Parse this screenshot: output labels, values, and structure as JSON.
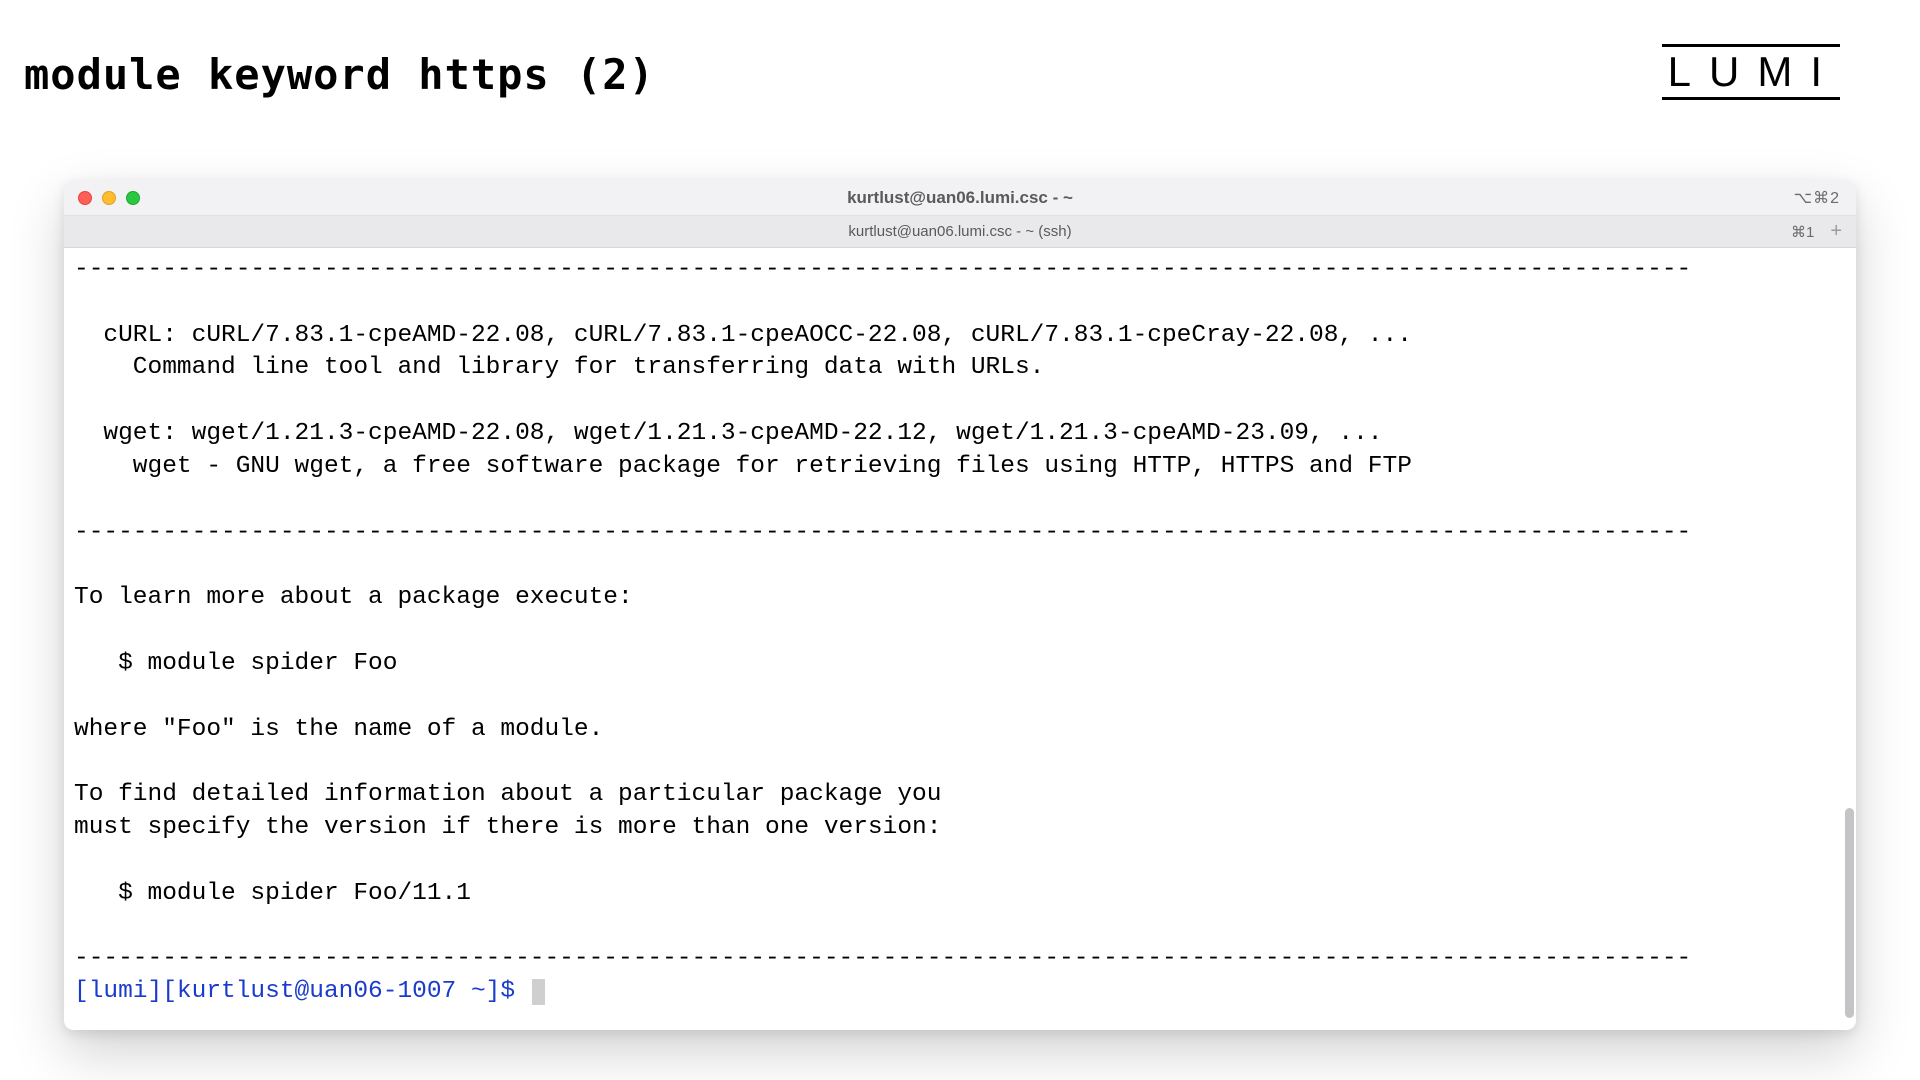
{
  "slide": {
    "title": "module keyword https (2)",
    "logo_text": "LUMI"
  },
  "window": {
    "title": "kurtlust@uan06.lumi.csc - ~",
    "right_indicator": "⌥⌘2",
    "tab_title": "kurtlust@uan06.lumi.csc - ~ (ssh)",
    "tab_right_indicator": "⌘1"
  },
  "terminal": {
    "hr": "--------------------------------------------------------------------------------------------------------------",
    "curl_line": "  cURL: cURL/7.83.1-cpeAMD-22.08, cURL/7.83.1-cpeAOCC-22.08, cURL/7.83.1-cpeCray-22.08, ...",
    "curl_desc": "    Command line tool and library for transferring data with URLs.",
    "wget_line": "  wget: wget/1.21.3-cpeAMD-22.08, wget/1.21.3-cpeAMD-22.12, wget/1.21.3-cpeAMD-23.09, ...",
    "wget_desc": "    wget - GNU wget, a free software package for retrieving files using HTTP, HTTPS and FTP",
    "help1": "To learn more about a package execute:",
    "help2": "   $ module spider Foo",
    "help3": "where \"Foo\" is the name of a module.",
    "help4": "To find detailed information about a particular package you",
    "help5": "must specify the version if there is more than one version:",
    "help6": "   $ module spider Foo/11.1",
    "prompt_blue": "[lumi][kurtlust@uan06-1007 ~]$"
  }
}
